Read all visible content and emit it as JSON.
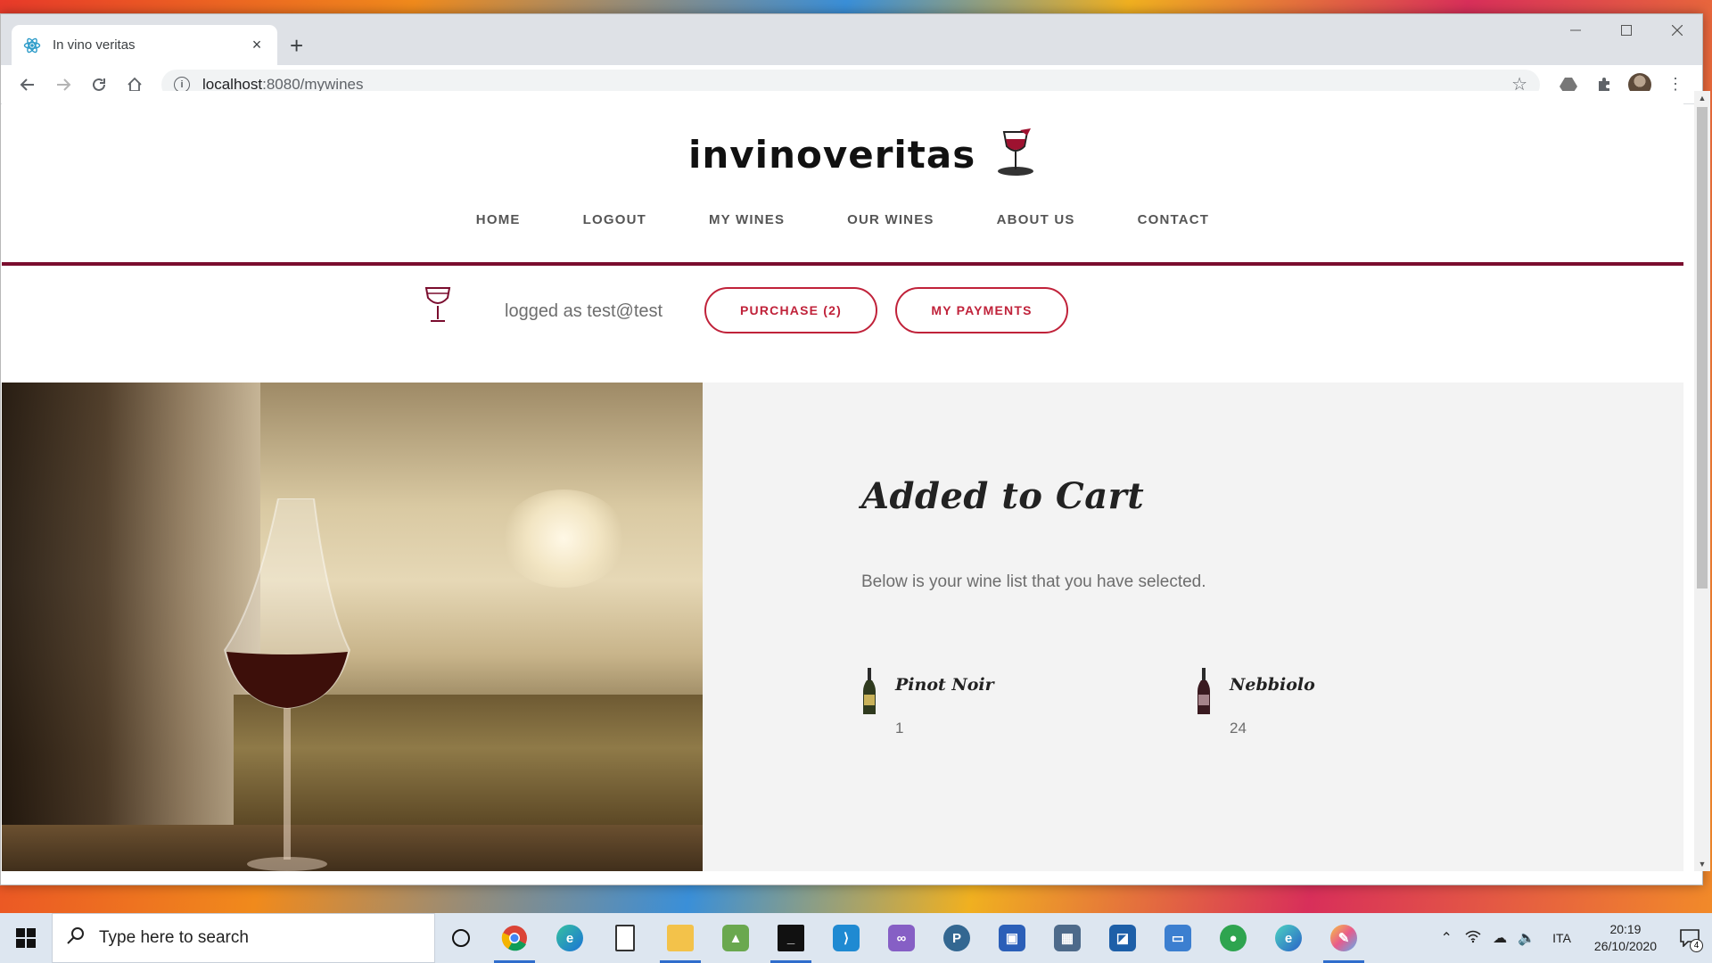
{
  "browser": {
    "tab_title": "In vino veritas",
    "tab_close": "×",
    "new_tab": "+",
    "url_host": "localhost",
    "url_path": ":8080/mywines",
    "colors": {
      "chrome_bg": "#dee1e6",
      "omnibox_bg": "#f1f3f4"
    }
  },
  "site": {
    "logo_text": "invinoveritas",
    "nav": [
      "HOME",
      "LOGOUT",
      "MY WINES",
      "OUR WINES",
      "ABOUT US",
      "CONTACT"
    ],
    "logged_as": "logged as test@test",
    "purchase_label": "PURCHASE (2)",
    "payments_label": "MY PAYMENTS",
    "accent_color": "#c0223a",
    "border_color": "#7a0d2e"
  },
  "cart": {
    "title": "Added to Cart",
    "subtitle": "Below is your wine list that you have selected.",
    "items": [
      {
        "name": "Pinot Noir",
        "qty": "1",
        "bottle_color": "#c9b25a"
      },
      {
        "name": "Nebbiolo",
        "qty": "24",
        "bottle_color": "#6b2330"
      }
    ]
  },
  "taskbar": {
    "search_placeholder": "Type here to search",
    "apps": [
      "chrome",
      "edge",
      "file",
      "explorer",
      "excel-like",
      "terminal",
      "vscode",
      "visual-studio",
      "postgres",
      "remote",
      "calculator",
      "app-blue",
      "app-window",
      "maps",
      "edge-dev",
      "paint"
    ],
    "language": "ITA",
    "time": "20:19",
    "date": "26/10/2020",
    "notification_count": "4"
  }
}
